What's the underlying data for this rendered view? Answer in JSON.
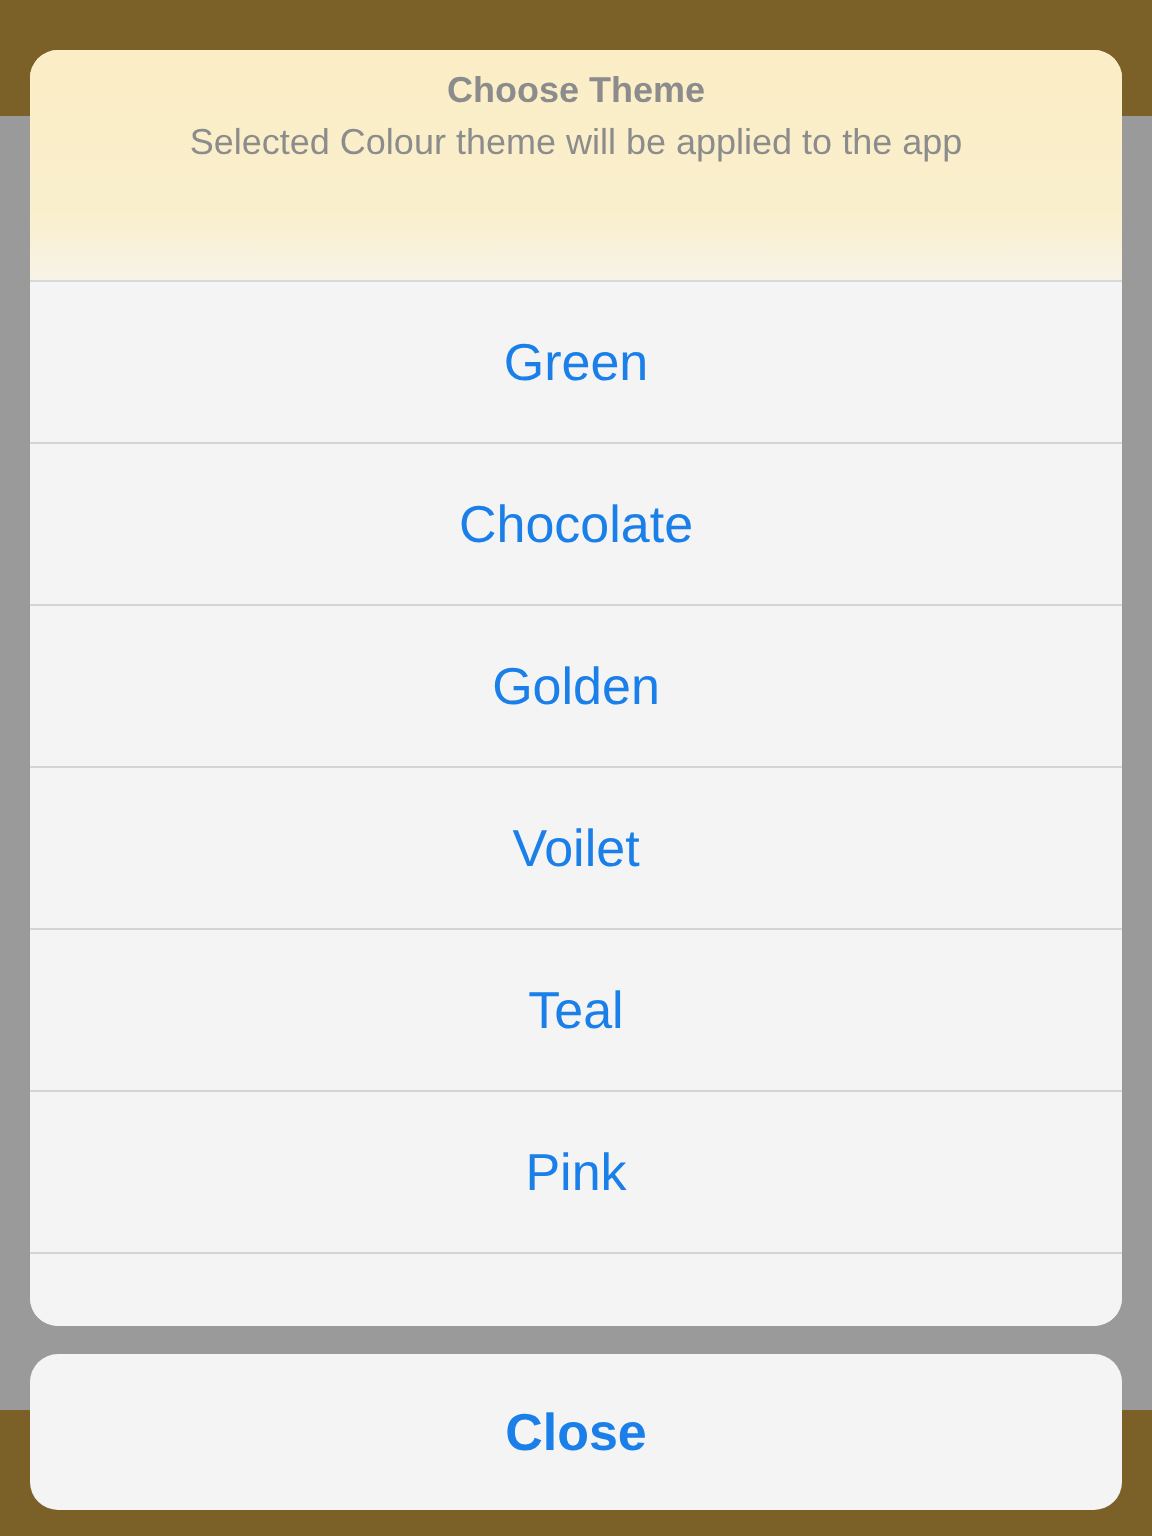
{
  "action_sheet": {
    "title": "Choose Theme",
    "message": "Selected Colour theme will be applied to the app",
    "options": [
      {
        "label": "Green"
      },
      {
        "label": "Chocolate"
      },
      {
        "label": "Golden"
      },
      {
        "label": "Voilet"
      },
      {
        "label": "Teal"
      },
      {
        "label": "Pink"
      }
    ],
    "cancel": "Close"
  }
}
